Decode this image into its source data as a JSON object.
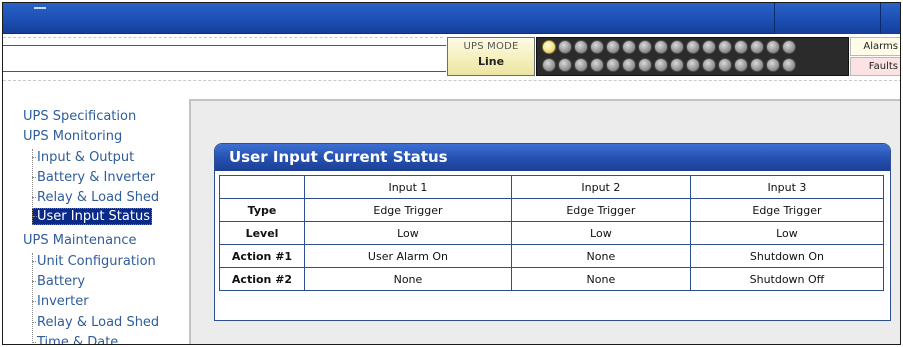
{
  "header": {
    "ups_mode_label": "UPS MODE",
    "ups_mode_value": "Line",
    "alarms_label": "Alarms",
    "faults_label": "Faults",
    "led_count_per_row": 16,
    "leds_lit_row1": 1,
    "leds_lit_row2": 0
  },
  "sidebar": {
    "sections": [
      {
        "label": "UPS Specification",
        "items": []
      },
      {
        "label": "UPS Monitoring",
        "items": [
          "Input & Output",
          "Battery & Inverter",
          "Relay & Load Shed",
          "User Input Status"
        ]
      },
      {
        "label": "UPS Maintenance",
        "items": [
          "Unit Configuration",
          "Battery",
          "Inverter",
          "Relay & Load Shed",
          "Time & Date"
        ]
      }
    ],
    "active_item": "User Input Status"
  },
  "panel": {
    "title": "User Input Current Status",
    "columns": [
      "Input 1",
      "Input 2",
      "Input 3"
    ],
    "rows": [
      {
        "label": "Type",
        "values": [
          "Edge Trigger",
          "Edge Trigger",
          "Edge Trigger"
        ]
      },
      {
        "label": "Level",
        "values": [
          "Low",
          "Low",
          "Low"
        ]
      },
      {
        "label": "Action #1",
        "values": [
          "User Alarm On",
          "None",
          "Shutdown On"
        ]
      },
      {
        "label": "Action #2",
        "values": [
          "None",
          "None",
          "Shutdown Off"
        ]
      }
    ]
  },
  "colors": {
    "banner_blue": "#1d4fb4",
    "nav_link": "#2f5d9b",
    "nav_active_bg": "#0b2a88",
    "panel_title_blue": "#2450b0",
    "led_lit": "#f3e48a",
    "alarms_bg": "#fffde8",
    "faults_bg": "#fbe3e3"
  }
}
